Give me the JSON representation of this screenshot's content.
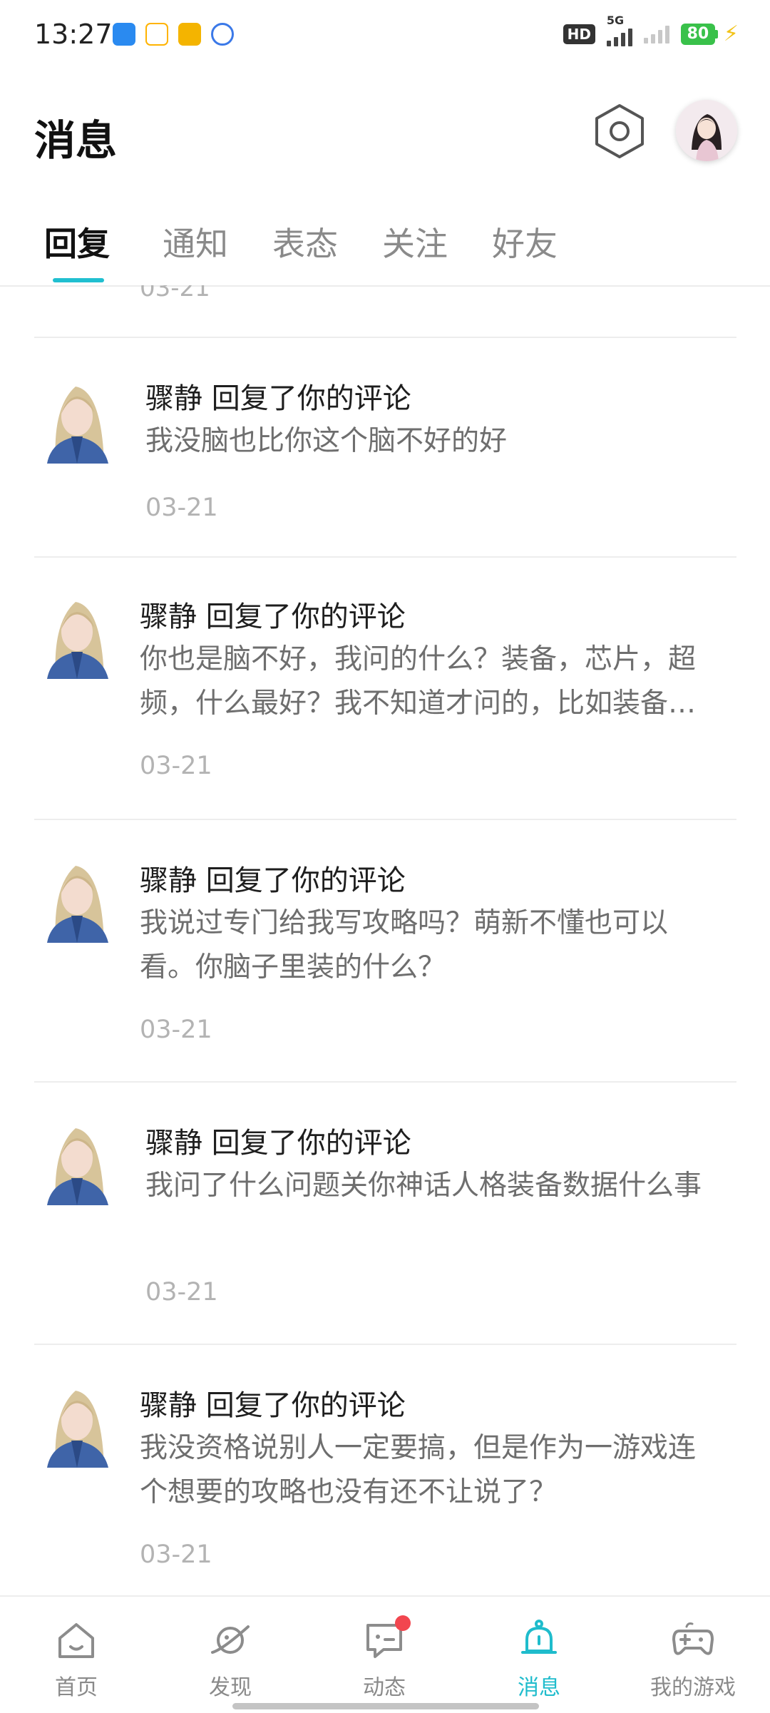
{
  "status_bar": {
    "time": "13:27",
    "hd_label": "HD",
    "network_label": "5G",
    "battery_level": "80",
    "app_icon_colors": [
      "#2a8af0",
      "#ffffff",
      "#f4b400",
      "#ffffff"
    ]
  },
  "header": {
    "title": "消息"
  },
  "tabs": [
    {
      "label": "回复",
      "active": true
    },
    {
      "label": "通知",
      "active": false
    },
    {
      "label": "表态",
      "active": false
    },
    {
      "label": "关注",
      "active": false
    },
    {
      "label": "好友",
      "active": false
    }
  ],
  "list": {
    "partial_item_date": "03-21",
    "items": [
      {
        "user": "骤静",
        "action": "回复了你的评论",
        "title": "骤静 回复了你的评论",
        "body": "我没脑也比你这个脑不好的好",
        "date": "03-21"
      },
      {
        "user": "骤静",
        "action": "回复了你的评论",
        "title": "骤静 回复了你的评论",
        "body": "你也是脑不好，我问的什么？装备，芯片，超频，什么最好？我不知道才问的，比如装备哪个好",
        "date": "03-21"
      },
      {
        "user": "骤静",
        "action": "回复了你的评论",
        "title": "骤静 回复了你的评论",
        "body": "我说过专门给我写攻略吗？萌新不懂也可以看。你脑子里装的什么？",
        "date": "03-21"
      },
      {
        "user": "骤静",
        "action": "回复了你的评论",
        "title": "骤静 回复了你的评论",
        "body": "我问了什么问题关你神话人格装备数据什么事",
        "date": "03-21"
      },
      {
        "user": "骤静",
        "action": "回复了你的评论",
        "title": "骤静 回复了你的评论",
        "body": "我没资格说别人一定要搞，但是作为一游戏连个想要的攻略也没有还不让说了？",
        "date": "03-21"
      }
    ]
  },
  "bottom_nav": [
    {
      "label": "首页",
      "icon": "home-icon",
      "active": false
    },
    {
      "label": "发现",
      "icon": "planet-icon",
      "active": false
    },
    {
      "label": "动态",
      "icon": "chat-icon",
      "active": false,
      "badge": true
    },
    {
      "label": "消息",
      "icon": "bell-icon",
      "active": true
    },
    {
      "label": "我的游戏",
      "icon": "gamepad-icon",
      "active": false
    }
  ],
  "colors": {
    "accent": "#20bfd0",
    "badge": "#f2464f",
    "battery": "#39c14a"
  }
}
